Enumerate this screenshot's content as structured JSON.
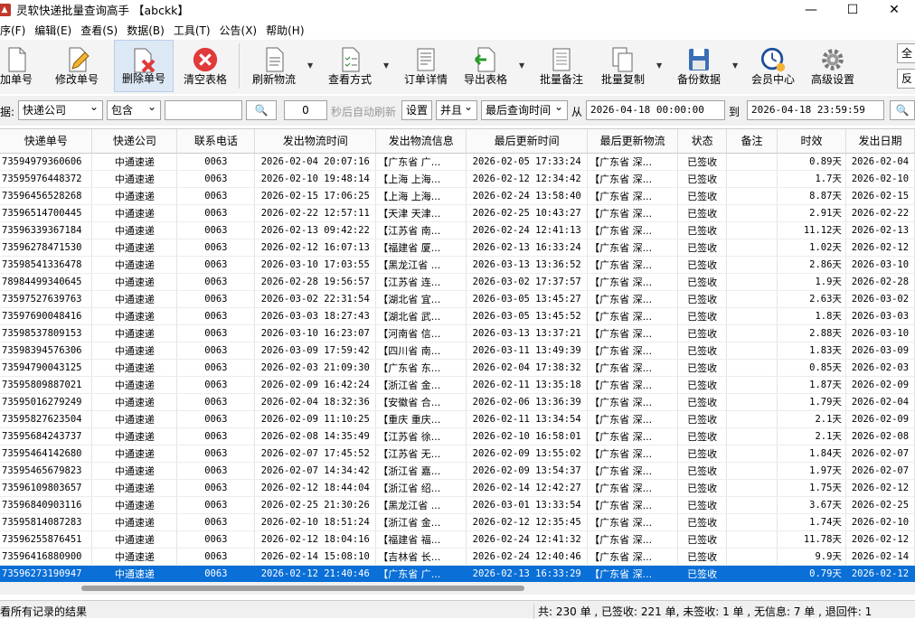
{
  "window": {
    "title": "灵软快递批量查询高手 【abckk】"
  },
  "menu": [
    "序(F)",
    "编辑(E)",
    "查看(S)",
    "数据(B)",
    "工具(T)",
    "公告(X)",
    "帮助(H)"
  ],
  "toolbar": {
    "add": "加单号",
    "edit": "修改单号",
    "delete": "删除单号",
    "clear": "清空表格",
    "refresh": "刷新物流",
    "view": "查看方式",
    "detail": "订单详情",
    "export": "导出表格",
    "batch_note": "批量备注",
    "batch_copy": "批量复制",
    "backup": "备份数据",
    "member": "会员中心",
    "advanced": "高级设置",
    "select_all": "全",
    "invert": "反"
  },
  "filter": {
    "label": "据:",
    "field": "快递公司",
    "op": "包含",
    "value": "",
    "count": "0",
    "auto_refresh": "秒后自动刷新",
    "settings": "设置",
    "logic": "并且",
    "time_field": "最后查询时间",
    "from_label": "从",
    "from": "2026-04-18 00:00:00",
    "to_label": "到",
    "to": "2026-04-18 23:59:59"
  },
  "table": {
    "columns": [
      "快递单号",
      "快递公司",
      "联系电话",
      "发出物流时间",
      "发出物流信息",
      "最后更新时间",
      "最后更新物流",
      "状态",
      "备注",
      "时效",
      "发出日期"
    ],
    "rows": [
      [
        "73594979360606",
        "中通速递",
        "0063",
        "2026-02-04 20:07:16",
        "【广东省 广...",
        "2026-02-05 17:33:24",
        "【广东省 深...",
        "已签收",
        "",
        "0.89天",
        "2026-02-04"
      ],
      [
        "73595976448372",
        "中通速递",
        "0063",
        "2026-02-10 19:48:14",
        "【上海 上海...",
        "2026-02-12 12:34:42",
        "【广东省 深...",
        "已签收",
        "",
        "1.7天",
        "2026-02-10"
      ],
      [
        "73596456528268",
        "中通速递",
        "0063",
        "2026-02-15 17:06:25",
        "【上海 上海...",
        "2026-02-24 13:58:40",
        "【广东省 深...",
        "已签收",
        "",
        "8.87天",
        "2026-02-15"
      ],
      [
        "73596514700445",
        "中通速递",
        "0063",
        "2026-02-22 12:57:11",
        "【天津 天津...",
        "2026-02-25 10:43:27",
        "【广东省 深...",
        "已签收",
        "",
        "2.91天",
        "2026-02-22"
      ],
      [
        "73596339367184",
        "中通速递",
        "0063",
        "2026-02-13 09:42:22",
        "【江苏省 南...",
        "2026-02-24 12:41:13",
        "【广东省 深...",
        "已签收",
        "",
        "11.12天",
        "2026-02-13"
      ],
      [
        "73596278471530",
        "中通速递",
        "0063",
        "2026-02-12 16:07:13",
        "【福建省 厦...",
        "2026-02-13 16:33:24",
        "【广东省 深...",
        "已签收",
        "",
        "1.02天",
        "2026-02-12"
      ],
      [
        "73598541336478",
        "中通速递",
        "0063",
        "2026-03-10 17:03:55",
        "【黑龙江省 ...",
        "2026-03-13 13:36:52",
        "【广东省 深...",
        "已签收",
        "",
        "2.86天",
        "2026-03-10"
      ],
      [
        "78984499340645",
        "中通速递",
        "0063",
        "2026-02-28 19:56:57",
        "【江苏省 连...",
        "2026-03-02 17:37:57",
        "【广东省 深...",
        "已签收",
        "",
        "1.9天",
        "2026-02-28"
      ],
      [
        "73597527639763",
        "中通速递",
        "0063",
        "2026-03-02 22:31:54",
        "【湖北省 宜...",
        "2026-03-05 13:45:27",
        "【广东省 深...",
        "已签收",
        "",
        "2.63天",
        "2026-03-02"
      ],
      [
        "73597690048416",
        "中通速递",
        "0063",
        "2026-03-03 18:27:43",
        "【湖北省 武...",
        "2026-03-05 13:45:52",
        "【广东省 深...",
        "已签收",
        "",
        "1.8天",
        "2026-03-03"
      ],
      [
        "73598537809153",
        "中通速递",
        "0063",
        "2026-03-10 16:23:07",
        "【河南省 信...",
        "2026-03-13 13:37:21",
        "【广东省 深...",
        "已签收",
        "",
        "2.88天",
        "2026-03-10"
      ],
      [
        "73598394576306",
        "中通速递",
        "0063",
        "2026-03-09 17:59:42",
        "【四川省 南...",
        "2026-03-11 13:49:39",
        "【广东省 深...",
        "已签收",
        "",
        "1.83天",
        "2026-03-09"
      ],
      [
        "73594790043125",
        "中通速递",
        "0063",
        "2026-02-03 21:09:30",
        "【广东省 东...",
        "2026-02-04 17:38:32",
        "【广东省 深...",
        "已签收",
        "",
        "0.85天",
        "2026-02-03"
      ],
      [
        "73595809887021",
        "中通速递",
        "0063",
        "2026-02-09 16:42:24",
        "【浙江省 金...",
        "2026-02-11 13:35:18",
        "【广东省 深...",
        "已签收",
        "",
        "1.87天",
        "2026-02-09"
      ],
      [
        "73595016279249",
        "中通速递",
        "0063",
        "2026-02-04 18:32:36",
        "【安徽省 合...",
        "2026-02-06 13:36:39",
        "【广东省 深...",
        "已签收",
        "",
        "1.79天",
        "2026-02-04"
      ],
      [
        "73595827623504",
        "中通速递",
        "0063",
        "2026-02-09 11:10:25",
        "【重庆 重庆...",
        "2026-02-11 13:34:54",
        "【广东省 深...",
        "已签收",
        "",
        "2.1天",
        "2026-02-09"
      ],
      [
        "73595684243737",
        "中通速递",
        "0063",
        "2026-02-08 14:35:49",
        "【江苏省 徐...",
        "2026-02-10 16:58:01",
        "【广东省 深...",
        "已签收",
        "",
        "2.1天",
        "2026-02-08"
      ],
      [
        "73595464142680",
        "中通速递",
        "0063",
        "2026-02-07 17:45:52",
        "【江苏省 无...",
        "2026-02-09 13:55:02",
        "【广东省 深...",
        "已签收",
        "",
        "1.84天",
        "2026-02-07"
      ],
      [
        "73595465679823",
        "中通速递",
        "0063",
        "2026-02-07 14:34:42",
        "【浙江省 嘉...",
        "2026-02-09 13:54:37",
        "【广东省 深...",
        "已签收",
        "",
        "1.97天",
        "2026-02-07"
      ],
      [
        "73596109803657",
        "中通速递",
        "0063",
        "2026-02-12 18:44:04",
        "【浙江省 绍...",
        "2026-02-14 12:42:27",
        "【广东省 深...",
        "已签收",
        "",
        "1.75天",
        "2026-02-12"
      ],
      [
        "73596840903116",
        "中通速递",
        "0063",
        "2026-02-25 21:30:26",
        "【黑龙江省 ...",
        "2026-03-01 13:33:54",
        "【广东省 深...",
        "已签收",
        "",
        "3.67天",
        "2026-02-25"
      ],
      [
        "73595814087283",
        "中通速递",
        "0063",
        "2026-02-10 18:51:24",
        "【浙江省 金...",
        "2026-02-12 12:35:45",
        "【广东省 深...",
        "已签收",
        "",
        "1.74天",
        "2026-02-10"
      ],
      [
        "73596255876451",
        "中通速递",
        "0063",
        "2026-02-12 18:04:16",
        "【福建省 福...",
        "2026-02-24 12:41:32",
        "【广东省 深...",
        "已签收",
        "",
        "11.78天",
        "2026-02-12"
      ],
      [
        "73596416880900",
        "中通速递",
        "0063",
        "2026-02-14 15:08:10",
        "【吉林省 长...",
        "2026-02-24 12:40:46",
        "【广东省 深...",
        "已签收",
        "",
        "9.9天",
        "2026-02-14"
      ],
      [
        "73596273190947",
        "中通速递",
        "0063",
        "2026-02-12 21:40:46",
        "【广东省 广...",
        "2026-02-13 16:33:29",
        "【广东省 深...",
        "已签收",
        "",
        "0.79天",
        "2026-02-12"
      ]
    ]
  },
  "status": {
    "left": "看所有记录的结果",
    "right": "共: 230 单 , 已签收: 221 单, 未签收: 1 单 , 无信息: 7 单 , 退回件: 1"
  },
  "colors": {
    "selection": "#0a6fd6",
    "delete_red": "#e03a3a"
  }
}
